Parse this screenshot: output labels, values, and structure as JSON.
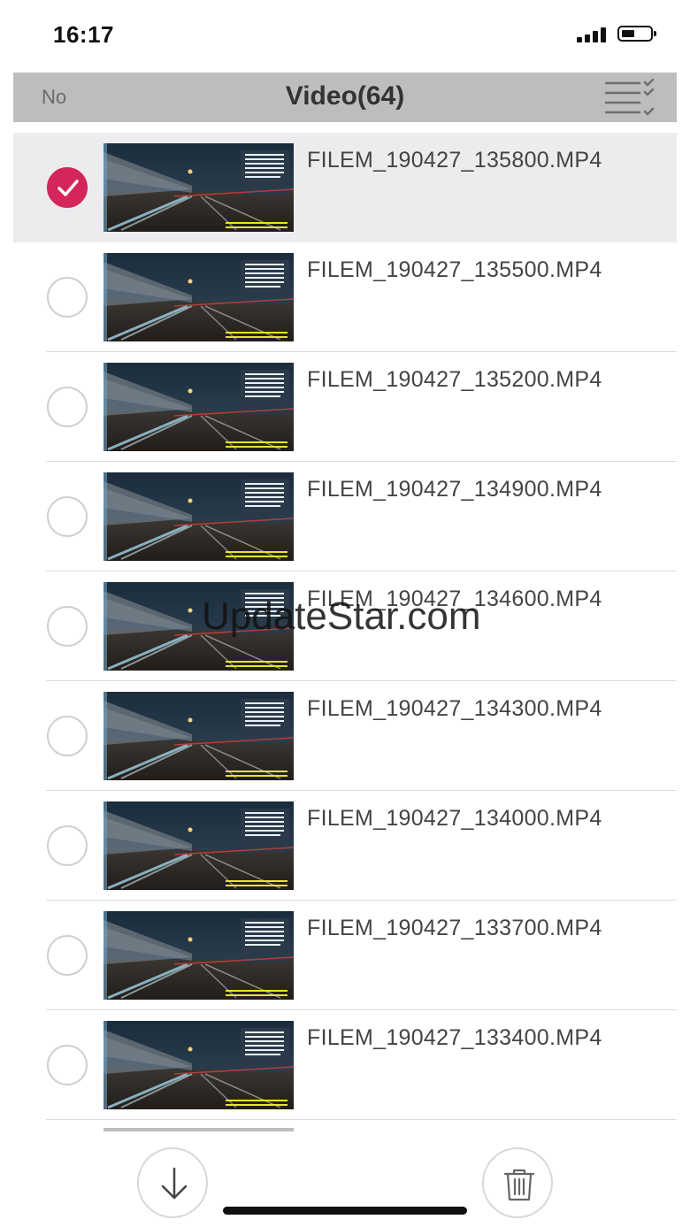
{
  "status": {
    "time": "16:17"
  },
  "nav": {
    "left_label": "No",
    "title": "Video(64)"
  },
  "files": [
    {
      "name": "FILEM_190427_135800.MP4",
      "selected": true
    },
    {
      "name": "FILEM_190427_135500.MP4",
      "selected": false
    },
    {
      "name": "FILEM_190427_135200.MP4",
      "selected": false
    },
    {
      "name": "FILEM_190427_134900.MP4",
      "selected": false
    },
    {
      "name": "FILEM_190427_134600.MP4",
      "selected": false
    },
    {
      "name": "FILEM_190427_134300.MP4",
      "selected": false
    },
    {
      "name": "FILEM_190427_134000.MP4",
      "selected": false
    },
    {
      "name": "FILEM_190427_133700.MP4",
      "selected": false
    },
    {
      "name": "FILEM_190427_133400.MP4",
      "selected": false
    }
  ],
  "watermark": "UpdateStar.com",
  "icons": {
    "select_mode": "checklist-icon",
    "download": "download-arrow-icon",
    "delete": "trash-icon",
    "selected_check": "checkmark-icon"
  },
  "colors": {
    "accent": "#d4265a",
    "nav_bg": "#bdbdbd",
    "selected_row_bg": "#ececef"
  }
}
